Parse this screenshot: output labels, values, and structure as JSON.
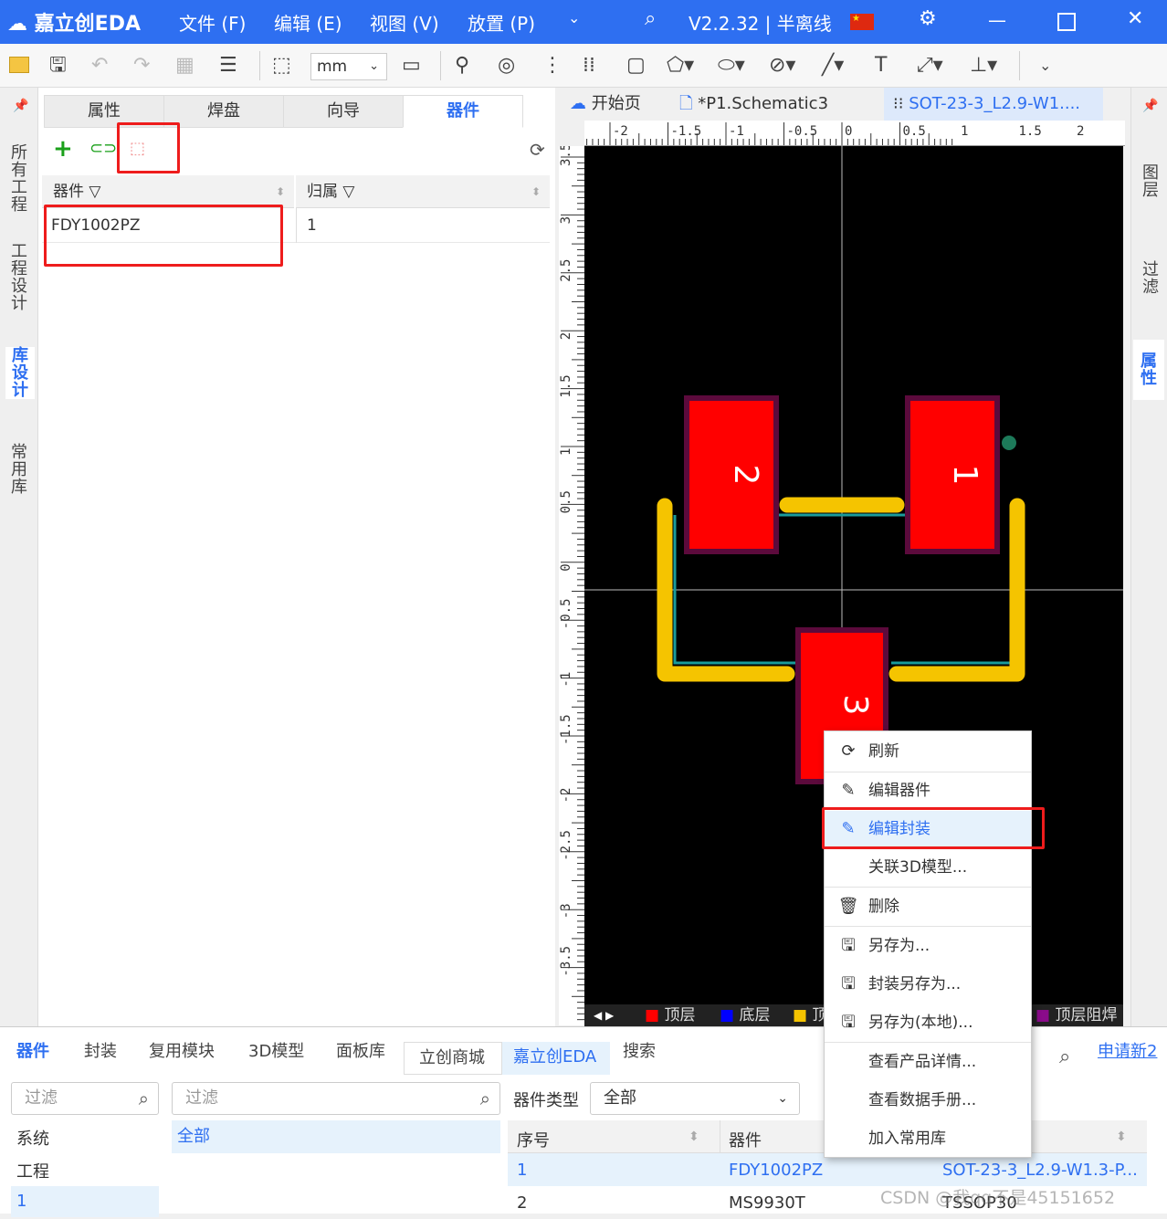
{
  "app": {
    "logo": "嘉立创EDA",
    "menu": [
      "文件 (F)",
      "编辑 (E)",
      "视图 (V)",
      "放置 (P)"
    ],
    "version": "V2.2.32 | 半离线",
    "brand_color": "#2e6ff1"
  },
  "toolbar": {
    "unit_select": "mm"
  },
  "left_tabs": [
    "所有工程",
    "工程设计",
    "库设计",
    "常用库"
  ],
  "panel": {
    "tabs": [
      "属性",
      "焊盘",
      "向导",
      "器件"
    ],
    "active_tab": "器件",
    "columns": [
      "器件",
      "归属"
    ],
    "rows": [
      {
        "device": "FDY1002PZ",
        "owner": "1"
      }
    ]
  },
  "doc_tabs": [
    "开始页",
    "*P1.Schematic3",
    "SOT-23-3_L2.9-W1...."
  ],
  "ruler_top_labels": [
    "-2",
    "-1.5",
    "-1",
    "-0.5",
    "0",
    "0.5",
    "1",
    "1.5",
    "2"
  ],
  "ruler_left_labels": [
    "3.5",
    "3",
    "2.5",
    "2",
    "1.5",
    "1",
    "0.5",
    "0",
    "-0.5",
    "-1",
    "-1.5",
    "-2",
    "-2.5",
    "-3",
    "-3.5"
  ],
  "pads": [
    "2",
    "1",
    "3"
  ],
  "layers": [
    "顶层",
    "底层",
    "顶",
    "顶层阻焊"
  ],
  "right_tabs": [
    "图层",
    "过滤",
    "属性"
  ],
  "context_menu": [
    {
      "label": "刷新",
      "icon": "refresh-icon"
    },
    {
      "label": "编辑器件",
      "icon": "pencil-icon"
    },
    {
      "label": "编辑封装",
      "icon": "pencil-icon",
      "active": true
    },
    {
      "label": "关联3D模型...",
      "icon": ""
    },
    {
      "label": "删除",
      "icon": "trash-icon"
    },
    {
      "label": "另存为...",
      "icon": "save-icon"
    },
    {
      "label": "封装另存为...",
      "icon": "save-icon"
    },
    {
      "label": "另存为(本地)...",
      "icon": "save-icon"
    },
    {
      "label": "查看产品详情...",
      "icon": ""
    },
    {
      "label": "查看数据手册...",
      "icon": ""
    },
    {
      "label": "加入常用库",
      "icon": ""
    }
  ],
  "bottom": {
    "tabs": [
      "器件",
      "封装",
      "复用模块",
      "3D模型",
      "面板库",
      "立创商城",
      "嘉立创EDA",
      "搜索"
    ],
    "apply_link": "申请新2",
    "filter_placeholder": "过滤",
    "tree": [
      "系统",
      "工程",
      "1"
    ],
    "category_all": "全部",
    "type_label": "器件类型",
    "type_value": "全部",
    "table_columns": [
      "序号",
      "器件"
    ],
    "table_rows": [
      {
        "index": "1",
        "device": "FDY1002PZ",
        "footprint": "SOT-23-3_L2.9-W1.3-P..."
      },
      {
        "index": "2",
        "device": "MS9930T",
        "footprint": "TSSOP30"
      }
    ],
    "watermark": "CSDN @我qq不是45151652"
  }
}
